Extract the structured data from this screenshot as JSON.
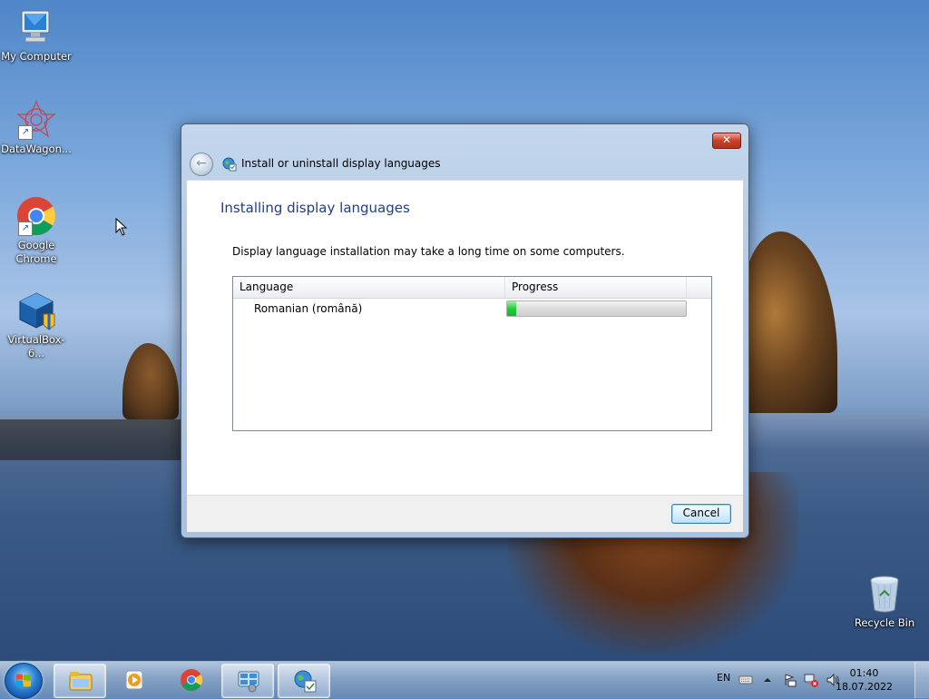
{
  "desktop": {
    "icons": [
      {
        "label": "My Computer",
        "icon": "computer-icon"
      },
      {
        "label": "DataWagon...",
        "icon": "datawagon-icon"
      },
      {
        "label": "Google Chrome",
        "icon": "chrome-icon"
      },
      {
        "label": "VirtualBox-6...",
        "icon": "virtualbox-icon"
      },
      {
        "label": "Recycle Bin",
        "icon": "recycle-bin-icon"
      }
    ]
  },
  "dialog": {
    "title": "Install or uninstall display languages",
    "close_glyph": "✕",
    "back_glyph": "←",
    "heading": "Installing display languages",
    "description": "Display language installation may take a long time on some computers.",
    "list": {
      "columns": [
        "Language",
        "Progress"
      ],
      "rows": [
        {
          "language": "Romanian (română)",
          "progress": 0.05
        }
      ]
    },
    "cancel_label": "Cancel"
  },
  "taskbar": {
    "items": [
      "start-button",
      "explorer",
      "media-player",
      "chrome",
      "control-panel",
      "language-installer"
    ],
    "active_item": "language-installer",
    "tray": {
      "language": "EN",
      "time": "01:40",
      "date": "18.07.2022"
    }
  },
  "colors": {
    "heading": "#1e3d8a",
    "progress_fill": "#1fcf3c",
    "close_button": "#c7412a"
  }
}
